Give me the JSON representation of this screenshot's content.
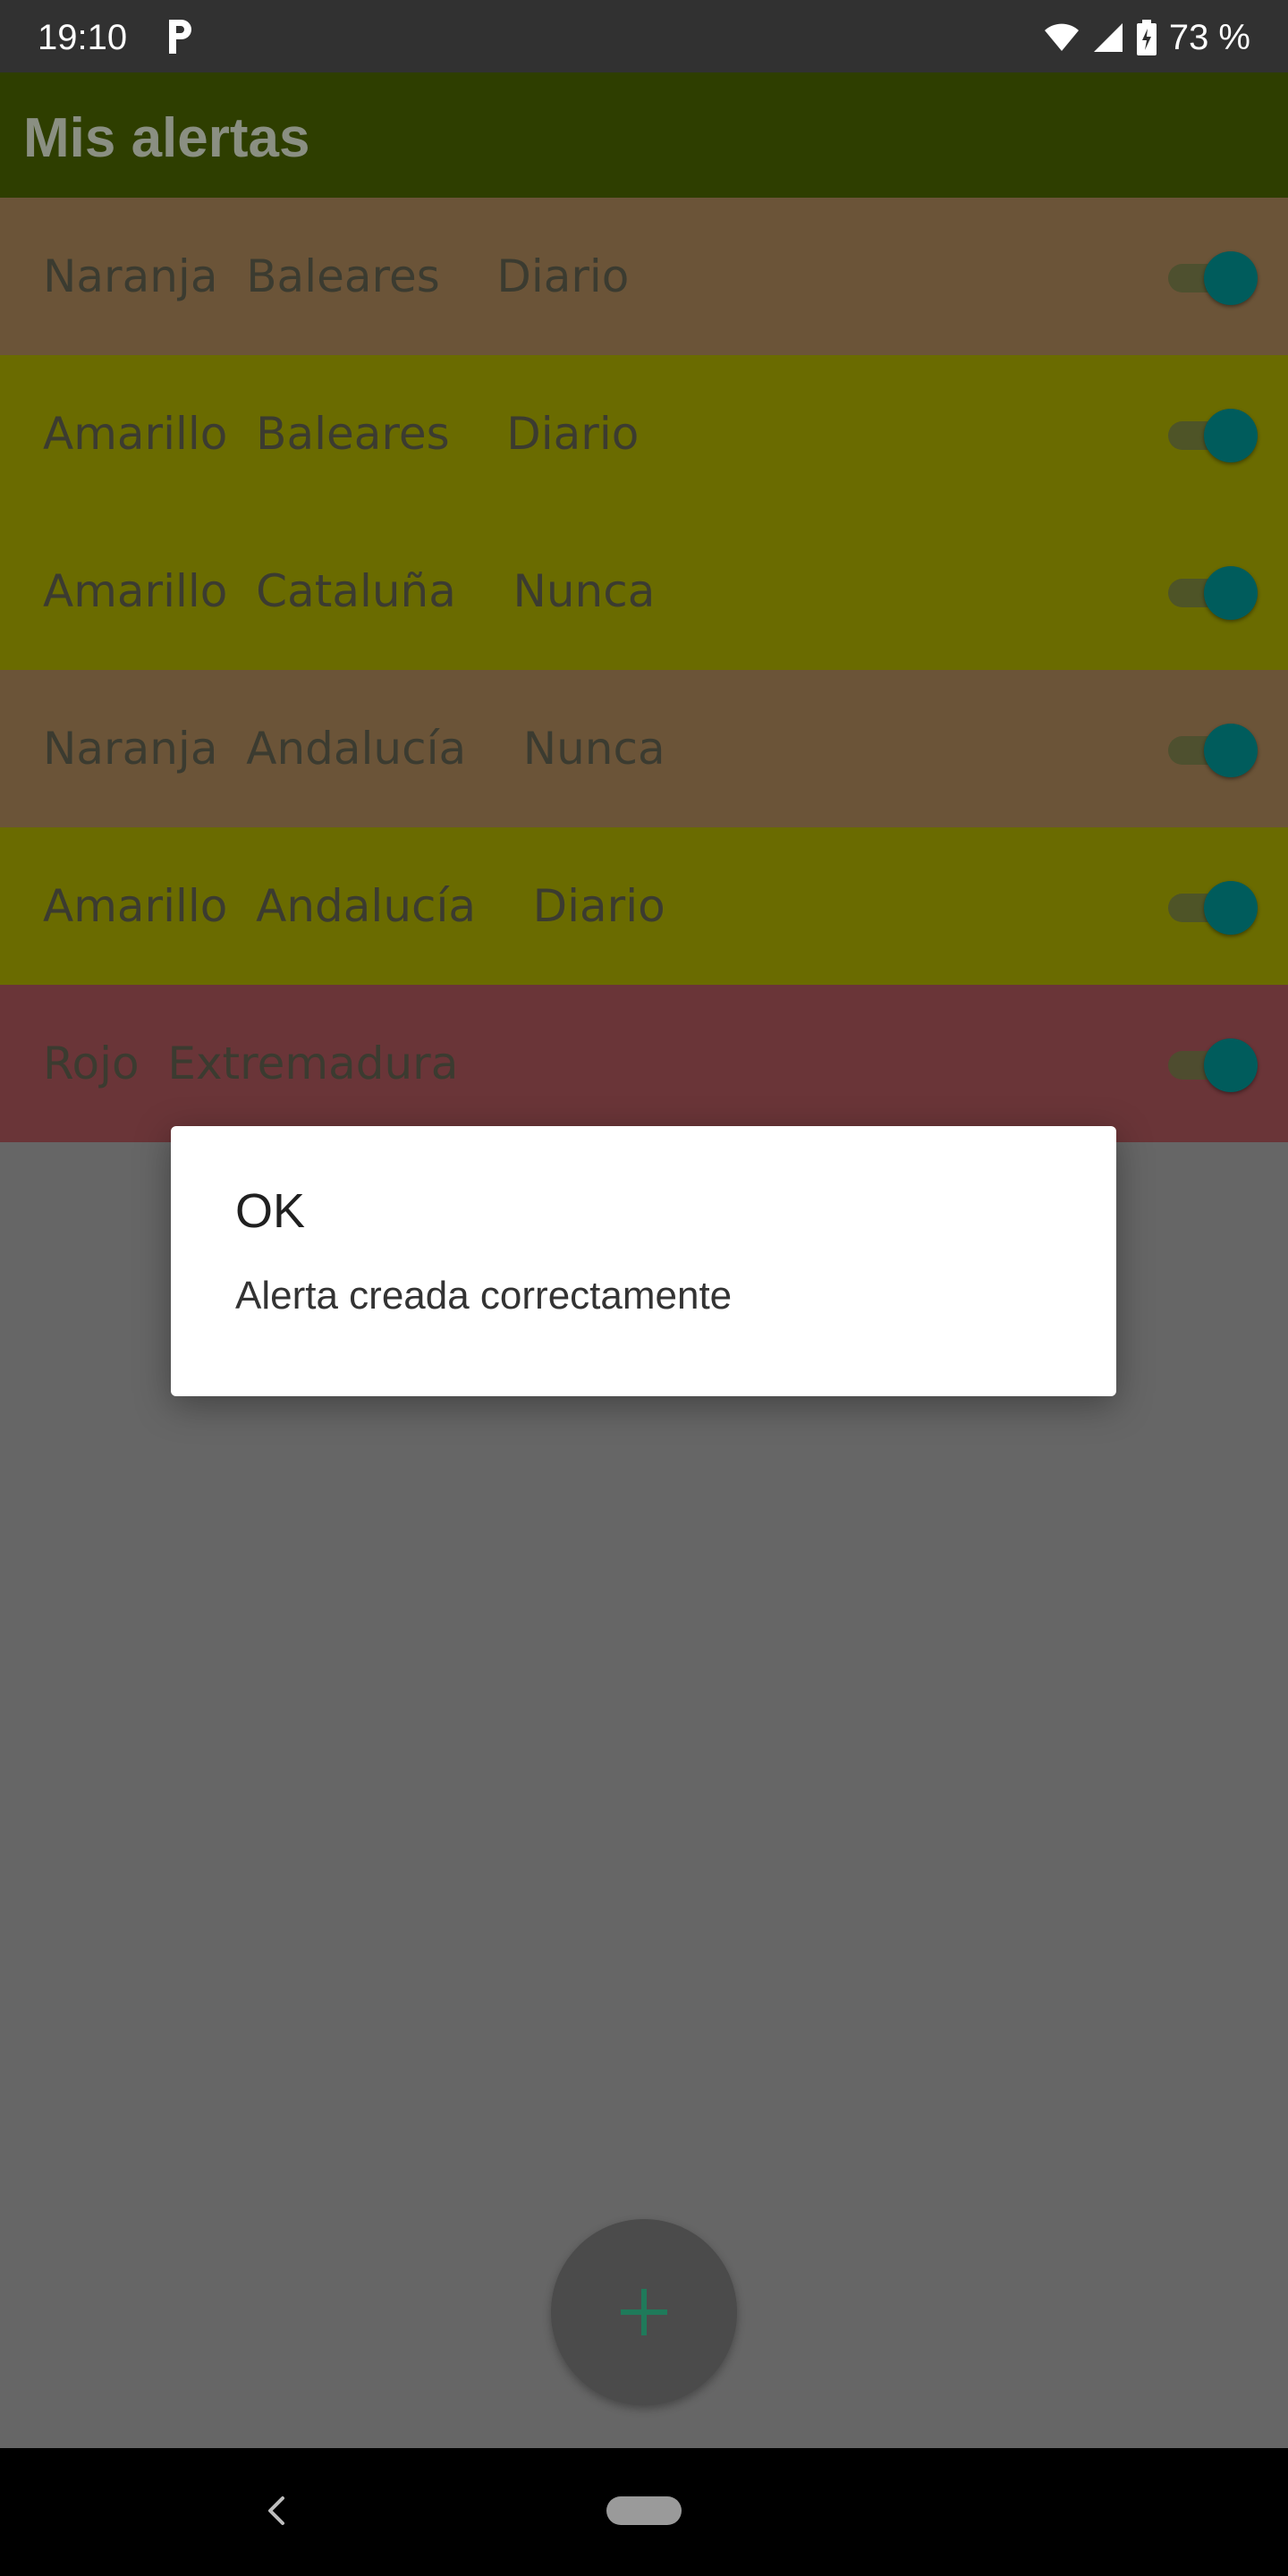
{
  "status_bar": {
    "time": "19:10",
    "battery_text": "73 %",
    "icons": [
      "parking-icon",
      "wifi-icon",
      "signal-icon",
      "battery-charging-icon"
    ]
  },
  "app_bar": {
    "title": "Mis alertas"
  },
  "alerts": [
    {
      "label": "Naranja  Baleares    Diario",
      "color": "#6b5438",
      "enabled": true
    },
    {
      "label": "Amarillo  Baleares    Diario",
      "color": "#6a6b00",
      "enabled": true
    },
    {
      "label": "Amarillo  Cataluña    Nunca",
      "color": "#6a6b00",
      "enabled": true
    },
    {
      "label": "Naranja  Andalucía    Nunca",
      "color": "#6b5438",
      "enabled": true
    },
    {
      "label": "Amarillo  Andalucía    Diario",
      "color": "#6a6b00",
      "enabled": true
    },
    {
      "label": "Rojo  Extremadura",
      "color": "#6a3538",
      "enabled": true
    }
  ],
  "dialog": {
    "title": "OK",
    "message": "Alerta creada correctamente"
  },
  "fab": {
    "icon": "plus-icon",
    "color": "#1f7a5a"
  },
  "colors": {
    "overlay": "#666666",
    "toggle_thumb": "#005c5c"
  }
}
